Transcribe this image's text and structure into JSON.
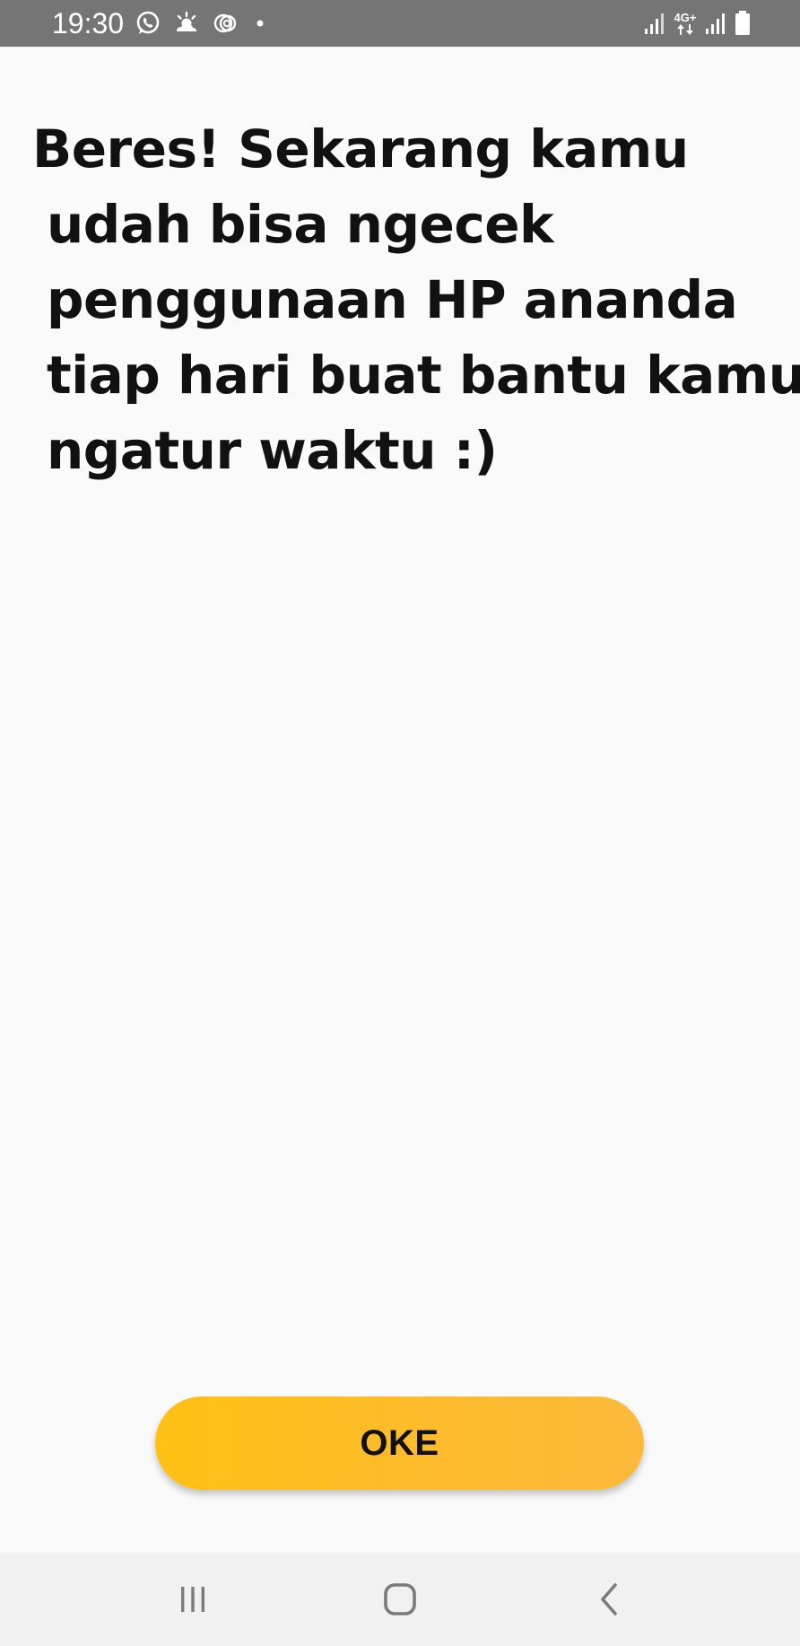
{
  "status_bar": {
    "time": "19:30",
    "left_icons": [
      "whatsapp-icon",
      "weather-sun-cloud-icon",
      "sync-circles-icon",
      "notification-dot-icon"
    ],
    "network_label": "4G+",
    "right_icons": [
      "signal-icon",
      "data-arrows-icon",
      "signal-icon",
      "battery-icon"
    ],
    "background_color": "#757575"
  },
  "message": {
    "lines": [
      "Beres! Sekarang kamu",
      "udah bisa ngecek",
      "penggunaan HP ananda",
      "tiap hari buat bantu kamu",
      "ngatur waktu :)"
    ]
  },
  "button": {
    "label": "OKE",
    "color": "#fec114"
  },
  "nav_bar": {
    "icons": [
      "recent-apps-icon",
      "home-icon",
      "back-icon"
    ]
  }
}
